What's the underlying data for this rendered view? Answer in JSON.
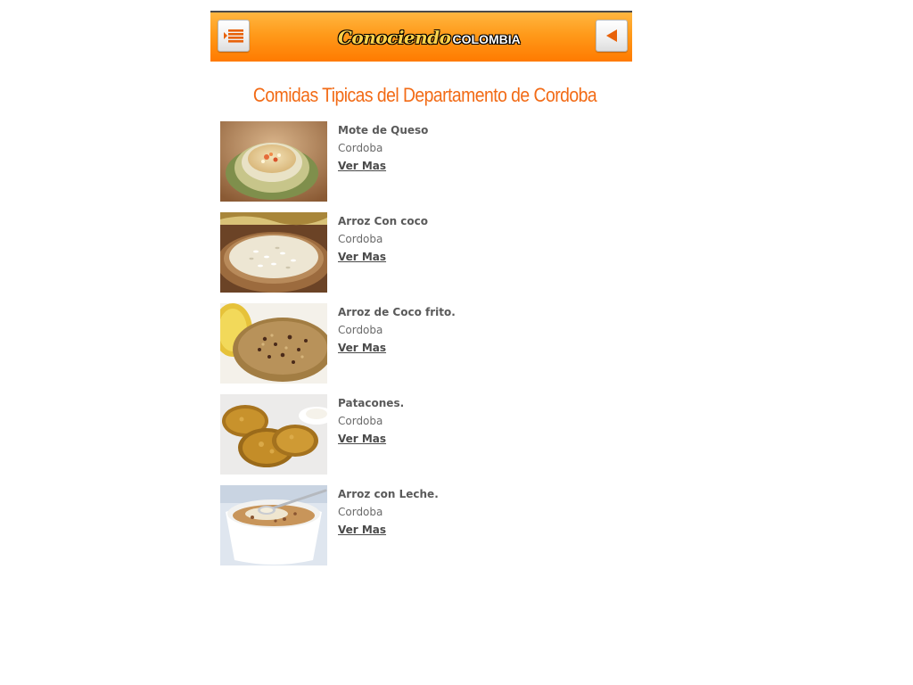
{
  "header": {
    "logo_script": "Conociendo",
    "logo_word": "COLOMBIA",
    "menu_icon": "menu-list-icon",
    "back_icon": "back-arrow-icon",
    "accent_color": "#ff8c00"
  },
  "page": {
    "title": "Comidas Tipicas del Departamento de Cordoba",
    "title_color": "#f26b16"
  },
  "items": [
    {
      "name": "Mote de Queso",
      "department": "Cordoba",
      "link": "Ver Mas",
      "image": "mote-de-queso-image"
    },
    {
      "name": "Arroz Con coco",
      "department": "Cordoba",
      "link": "Ver Mas",
      "image": "arroz-con-coco-image"
    },
    {
      "name": "Arroz de Coco frito.",
      "department": "Cordoba",
      "link": "Ver Mas",
      "image": "arroz-de-coco-frito-image"
    },
    {
      "name": "Patacones.",
      "department": "Cordoba",
      "link": "Ver Mas",
      "image": "patacones-image"
    },
    {
      "name": "Arroz con Leche.",
      "department": "Cordoba",
      "link": "Ver Mas",
      "image": "arroz-con-leche-image"
    }
  ]
}
